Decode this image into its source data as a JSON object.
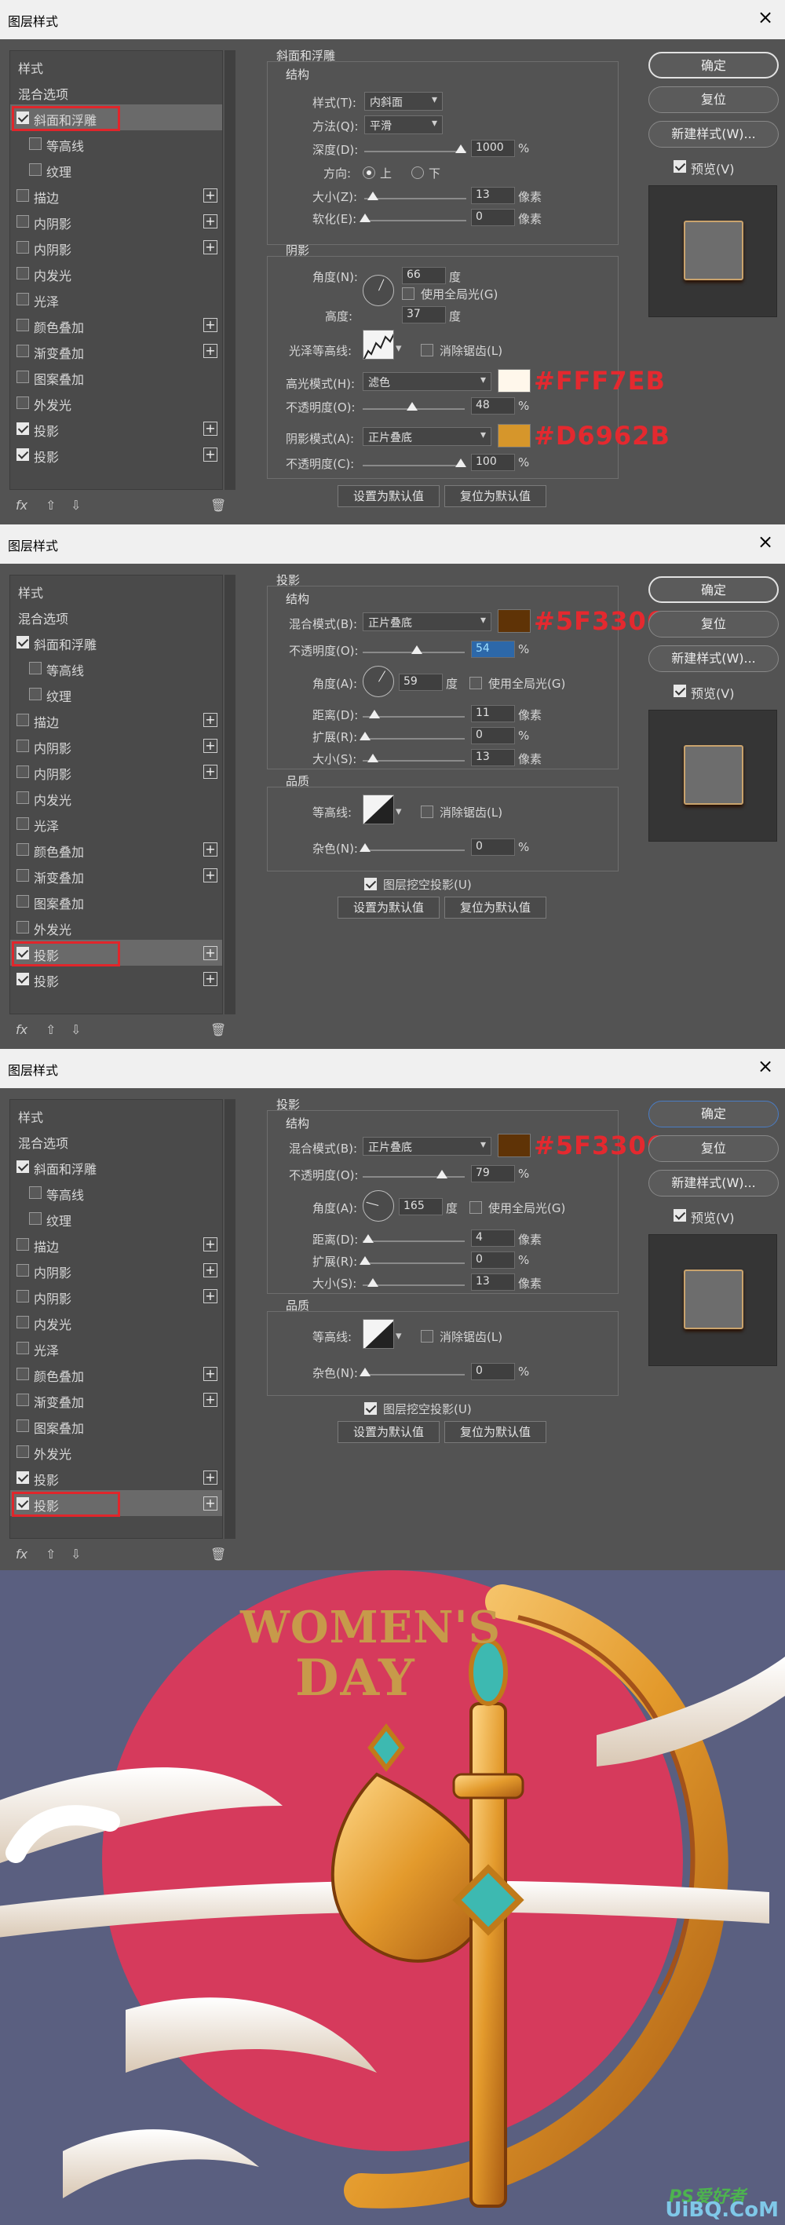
{
  "dialog_title": "图层样式",
  "close_glyph": "×",
  "colors": {
    "accent_red": "#e0262b",
    "highlight_color": "#FFF7EB",
    "shadow_color": "#D6962B",
    "drop_shadow_color": "#5F3306",
    "artwork_bg": "#5a5f80"
  },
  "style_list": {
    "header": "样式",
    "blend_options": "混合选项",
    "bevel": "斜面和浮雕",
    "contour": "等高线",
    "texture": "纹理",
    "stroke": "描边",
    "inner_shadow_1": "内阴影",
    "inner_shadow_2": "内阴影",
    "inner_glow": "内发光",
    "satin": "光泽",
    "color_overlay": "颜色叠加",
    "gradient_overlay": "渐变叠加",
    "pattern_overlay": "图案叠加",
    "outer_glow": "外发光",
    "drop_shadow_1": "投影",
    "drop_shadow_2": "投影",
    "fx": "fx",
    "up": "⇧",
    "down": "⇩",
    "trash": "🗑"
  },
  "right_buttons": {
    "ok": "确定",
    "reset": "复位",
    "new_style": "新建样式(W)...",
    "preview": "预览(V)"
  },
  "panel1": {
    "section": "斜面和浮雕",
    "structure": "结构",
    "style_label": "样式(T):",
    "style_value": "内斜面",
    "technique_label": "方法(Q):",
    "technique_value": "平滑",
    "depth_label": "深度(D):",
    "depth_value": "1000",
    "depth_unit": "%",
    "direction_label": "方向:",
    "dir_up": "上",
    "dir_down": "下",
    "size_label": "大小(Z):",
    "size_value": "13",
    "size_unit": "像素",
    "soften_label": "软化(E):",
    "soften_value": "0",
    "soften_unit": "像素",
    "shading": "阴影",
    "angle_label": "角度(N):",
    "angle_value": "66",
    "angle_unit": "度",
    "global_light": "使用全局光(G)",
    "altitude_label": "高度:",
    "altitude_value": "37",
    "altitude_unit": "度",
    "gloss_label": "光泽等高线:",
    "antialias": "消除锯齿(L)",
    "highlight_mode_label": "高光模式(H):",
    "highlight_mode_value": "滤色",
    "highlight_hex": "#FFF7EB",
    "opacity_label_1": "不透明度(O):",
    "opacity_value_1": "48",
    "opacity_unit": "%",
    "shadow_mode_label": "阴影模式(A):",
    "shadow_mode_value": "正片叠底",
    "shadow_hex": "#D6962B",
    "opacity_label_2": "不透明度(C):",
    "opacity_value_2": "100",
    "set_default": "设置为默认值",
    "reset_default": "复位为默认值"
  },
  "panel2": {
    "section": "投影",
    "structure": "结构",
    "blend_label": "混合模式(B):",
    "blend_value": "正片叠底",
    "hex": "#5F3306",
    "opacity_label": "不透明度(O):",
    "opacity_value": "54",
    "pct": "%",
    "angle_label": "角度(A):",
    "angle_value": "59",
    "angle_unit": "度",
    "global_light": "使用全局光(G)",
    "distance_label": "距离(D):",
    "distance_value": "11",
    "px": "像素",
    "spread_label": "扩展(R):",
    "spread_value": "0",
    "size_label": "大小(S):",
    "size_value": "13",
    "quality": "品质",
    "contour_label": "等高线:",
    "antialias": "消除锯齿(L)",
    "noise_label": "杂色(N):",
    "noise_value": "0",
    "knockout": "图层挖空投影(U)",
    "set_default": "设置为默认值",
    "reset_default": "复位为默认值"
  },
  "panel3": {
    "section": "投影",
    "structure": "结构",
    "blend_label": "混合模式(B):",
    "blend_value": "正片叠底",
    "hex": "#5F3306",
    "opacity_label": "不透明度(O):",
    "opacity_value": "79",
    "pct": "%",
    "angle_label": "角度(A):",
    "angle_value": "165",
    "angle_unit": "度",
    "global_light": "使用全局光(G)",
    "distance_label": "距离(D):",
    "distance_value": "4",
    "px": "像素",
    "spread_label": "扩展(R):",
    "spread_value": "0",
    "size_label": "大小(S):",
    "size_value": "13",
    "quality": "品质",
    "contour_label": "等高线:",
    "antialias": "消除锯齿(L)",
    "noise_label": "杂色(N):",
    "noise_value": "0",
    "knockout": "图层挖空投影(U)",
    "set_default": "设置为默认值",
    "reset_default": "复位为默认值"
  },
  "artwork": {
    "line1": "WOMEN'S",
    "line2": "DAY",
    "watermark_1": "PS爱好者",
    "watermark_2": "UiBQ.CoM"
  }
}
